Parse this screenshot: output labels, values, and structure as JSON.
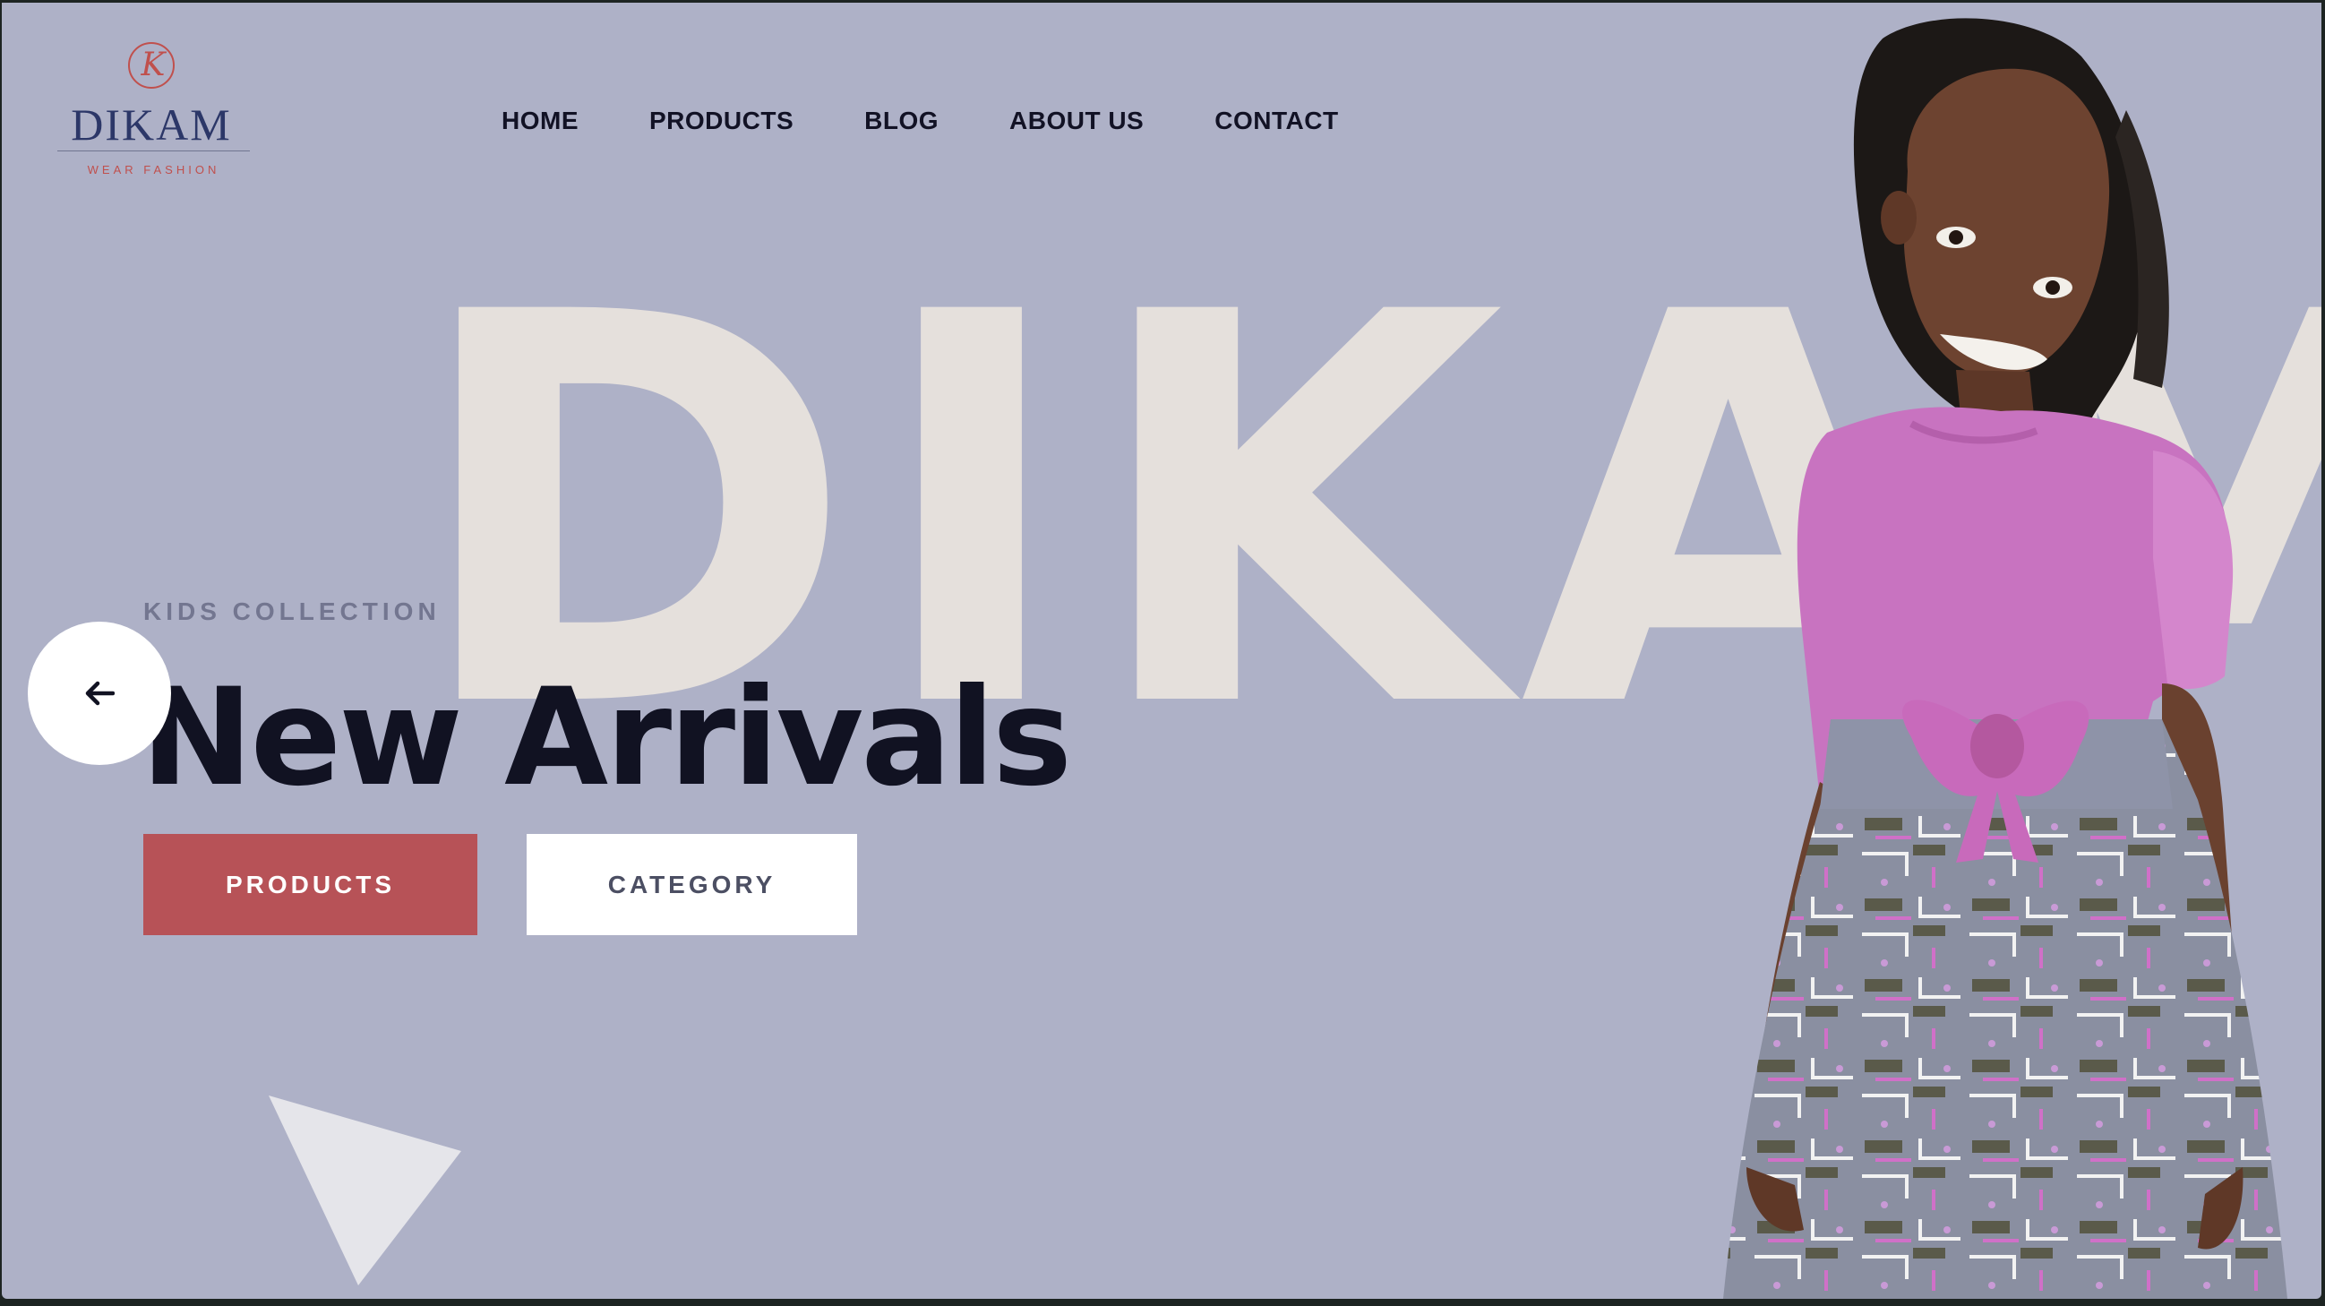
{
  "brand": {
    "logo_mark": "K",
    "name": "DIKAM",
    "tagline": "WEAR FASHION"
  },
  "nav": {
    "items": [
      "HOME",
      "PRODUCTS",
      "BLOG",
      "ABOUT US",
      "CONTACT"
    ]
  },
  "hero": {
    "background_word": "DIKAM",
    "overline": "KIDS COLLECTION",
    "headline": "New Arrivals",
    "primary_button": "PRODUCTS",
    "secondary_button": "CATEGORY",
    "prev_icon": "arrow-left-icon"
  },
  "colors": {
    "hero_bg": "#aeb1c7",
    "accent": "#b75257",
    "wordmark": "#e5e0dc",
    "text_dark": "#111222",
    "logo_navy": "#2c3768"
  }
}
